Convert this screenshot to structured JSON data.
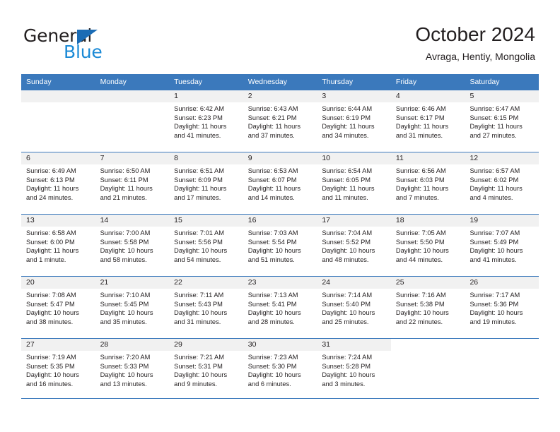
{
  "brand": {
    "name_top": "General",
    "name_bottom": "Blue",
    "triangle_color": "#1b6cb5",
    "blue_color": "#1b8ad6"
  },
  "header": {
    "title": "October 2024",
    "location": "Avraga, Hentiy, Mongolia"
  },
  "theme": {
    "header_blue": "#3b79bc",
    "daynum_band": "#f1f1f1",
    "text": "#231f20"
  },
  "weekdays": [
    "Sunday",
    "Monday",
    "Tuesday",
    "Wednesday",
    "Thursday",
    "Friday",
    "Saturday"
  ],
  "weeks": [
    [
      {
        "day": "",
        "sunrise": "",
        "sunset": "",
        "daylight": ""
      },
      {
        "day": "",
        "sunrise": "",
        "sunset": "",
        "daylight": ""
      },
      {
        "day": "1",
        "sunrise": "Sunrise: 6:42 AM",
        "sunset": "Sunset: 6:23 PM",
        "daylight": "Daylight: 11 hours and 41 minutes."
      },
      {
        "day": "2",
        "sunrise": "Sunrise: 6:43 AM",
        "sunset": "Sunset: 6:21 PM",
        "daylight": "Daylight: 11 hours and 37 minutes."
      },
      {
        "day": "3",
        "sunrise": "Sunrise: 6:44 AM",
        "sunset": "Sunset: 6:19 PM",
        "daylight": "Daylight: 11 hours and 34 minutes."
      },
      {
        "day": "4",
        "sunrise": "Sunrise: 6:46 AM",
        "sunset": "Sunset: 6:17 PM",
        "daylight": "Daylight: 11 hours and 31 minutes."
      },
      {
        "day": "5",
        "sunrise": "Sunrise: 6:47 AM",
        "sunset": "Sunset: 6:15 PM",
        "daylight": "Daylight: 11 hours and 27 minutes."
      }
    ],
    [
      {
        "day": "6",
        "sunrise": "Sunrise: 6:49 AM",
        "sunset": "Sunset: 6:13 PM",
        "daylight": "Daylight: 11 hours and 24 minutes."
      },
      {
        "day": "7",
        "sunrise": "Sunrise: 6:50 AM",
        "sunset": "Sunset: 6:11 PM",
        "daylight": "Daylight: 11 hours and 21 minutes."
      },
      {
        "day": "8",
        "sunrise": "Sunrise: 6:51 AM",
        "sunset": "Sunset: 6:09 PM",
        "daylight": "Daylight: 11 hours and 17 minutes."
      },
      {
        "day": "9",
        "sunrise": "Sunrise: 6:53 AM",
        "sunset": "Sunset: 6:07 PM",
        "daylight": "Daylight: 11 hours and 14 minutes."
      },
      {
        "day": "10",
        "sunrise": "Sunrise: 6:54 AM",
        "sunset": "Sunset: 6:05 PM",
        "daylight": "Daylight: 11 hours and 11 minutes."
      },
      {
        "day": "11",
        "sunrise": "Sunrise: 6:56 AM",
        "sunset": "Sunset: 6:03 PM",
        "daylight": "Daylight: 11 hours and 7 minutes."
      },
      {
        "day": "12",
        "sunrise": "Sunrise: 6:57 AM",
        "sunset": "Sunset: 6:02 PM",
        "daylight": "Daylight: 11 hours and 4 minutes."
      }
    ],
    [
      {
        "day": "13",
        "sunrise": "Sunrise: 6:58 AM",
        "sunset": "Sunset: 6:00 PM",
        "daylight": "Daylight: 11 hours and 1 minute."
      },
      {
        "day": "14",
        "sunrise": "Sunrise: 7:00 AM",
        "sunset": "Sunset: 5:58 PM",
        "daylight": "Daylight: 10 hours and 58 minutes."
      },
      {
        "day": "15",
        "sunrise": "Sunrise: 7:01 AM",
        "sunset": "Sunset: 5:56 PM",
        "daylight": "Daylight: 10 hours and 54 minutes."
      },
      {
        "day": "16",
        "sunrise": "Sunrise: 7:03 AM",
        "sunset": "Sunset: 5:54 PM",
        "daylight": "Daylight: 10 hours and 51 minutes."
      },
      {
        "day": "17",
        "sunrise": "Sunrise: 7:04 AM",
        "sunset": "Sunset: 5:52 PM",
        "daylight": "Daylight: 10 hours and 48 minutes."
      },
      {
        "day": "18",
        "sunrise": "Sunrise: 7:05 AM",
        "sunset": "Sunset: 5:50 PM",
        "daylight": "Daylight: 10 hours and 44 minutes."
      },
      {
        "day": "19",
        "sunrise": "Sunrise: 7:07 AM",
        "sunset": "Sunset: 5:49 PM",
        "daylight": "Daylight: 10 hours and 41 minutes."
      }
    ],
    [
      {
        "day": "20",
        "sunrise": "Sunrise: 7:08 AM",
        "sunset": "Sunset: 5:47 PM",
        "daylight": "Daylight: 10 hours and 38 minutes."
      },
      {
        "day": "21",
        "sunrise": "Sunrise: 7:10 AM",
        "sunset": "Sunset: 5:45 PM",
        "daylight": "Daylight: 10 hours and 35 minutes."
      },
      {
        "day": "22",
        "sunrise": "Sunrise: 7:11 AM",
        "sunset": "Sunset: 5:43 PM",
        "daylight": "Daylight: 10 hours and 31 minutes."
      },
      {
        "day": "23",
        "sunrise": "Sunrise: 7:13 AM",
        "sunset": "Sunset: 5:41 PM",
        "daylight": "Daylight: 10 hours and 28 minutes."
      },
      {
        "day": "24",
        "sunrise": "Sunrise: 7:14 AM",
        "sunset": "Sunset: 5:40 PM",
        "daylight": "Daylight: 10 hours and 25 minutes."
      },
      {
        "day": "25",
        "sunrise": "Sunrise: 7:16 AM",
        "sunset": "Sunset: 5:38 PM",
        "daylight": "Daylight: 10 hours and 22 minutes."
      },
      {
        "day": "26",
        "sunrise": "Sunrise: 7:17 AM",
        "sunset": "Sunset: 5:36 PM",
        "daylight": "Daylight: 10 hours and 19 minutes."
      }
    ],
    [
      {
        "day": "27",
        "sunrise": "Sunrise: 7:19 AM",
        "sunset": "Sunset: 5:35 PM",
        "daylight": "Daylight: 10 hours and 16 minutes."
      },
      {
        "day": "28",
        "sunrise": "Sunrise: 7:20 AM",
        "sunset": "Sunset: 5:33 PM",
        "daylight": "Daylight: 10 hours and 13 minutes."
      },
      {
        "day": "29",
        "sunrise": "Sunrise: 7:21 AM",
        "sunset": "Sunset: 5:31 PM",
        "daylight": "Daylight: 10 hours and 9 minutes."
      },
      {
        "day": "30",
        "sunrise": "Sunrise: 7:23 AM",
        "sunset": "Sunset: 5:30 PM",
        "daylight": "Daylight: 10 hours and 6 minutes."
      },
      {
        "day": "31",
        "sunrise": "Sunrise: 7:24 AM",
        "sunset": "Sunset: 5:28 PM",
        "daylight": "Daylight: 10 hours and 3 minutes."
      },
      {
        "day": "",
        "sunrise": "",
        "sunset": "",
        "daylight": ""
      },
      {
        "day": "",
        "sunrise": "",
        "sunset": "",
        "daylight": ""
      }
    ]
  ]
}
